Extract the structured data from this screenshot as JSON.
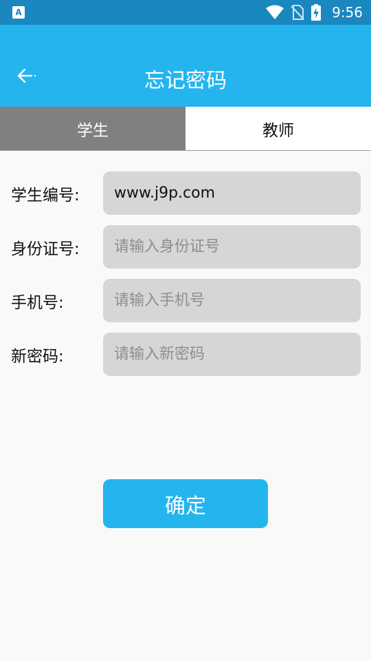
{
  "status_bar": {
    "app_badge": "A",
    "time": "9:56",
    "icons": [
      "wifi-icon",
      "no-sim-icon",
      "battery-charging-icon"
    ]
  },
  "header": {
    "title": "忘记密码",
    "back_icon": "arrow-left-icon"
  },
  "tabs": [
    {
      "label": "学生",
      "active": true
    },
    {
      "label": "教师",
      "active": false
    }
  ],
  "form": {
    "student_id": {
      "label": "学生编号:",
      "value": "www.j9p.com",
      "placeholder": ""
    },
    "id_card": {
      "label": "身份证号:",
      "value": "",
      "placeholder": "请输入身份证号"
    },
    "phone": {
      "label": "手机号:",
      "value": "",
      "placeholder": "请输入手机号"
    },
    "new_password": {
      "label": "新密码:",
      "value": "",
      "placeholder": "请输入新密码"
    }
  },
  "submit_label": "确定",
  "colors": {
    "status_bar": "#1a87bf",
    "primary": "#24b5ef",
    "tab_active": "#808080",
    "input_bg": "#d6d6d6",
    "page_bg": "#f9f9f9"
  }
}
